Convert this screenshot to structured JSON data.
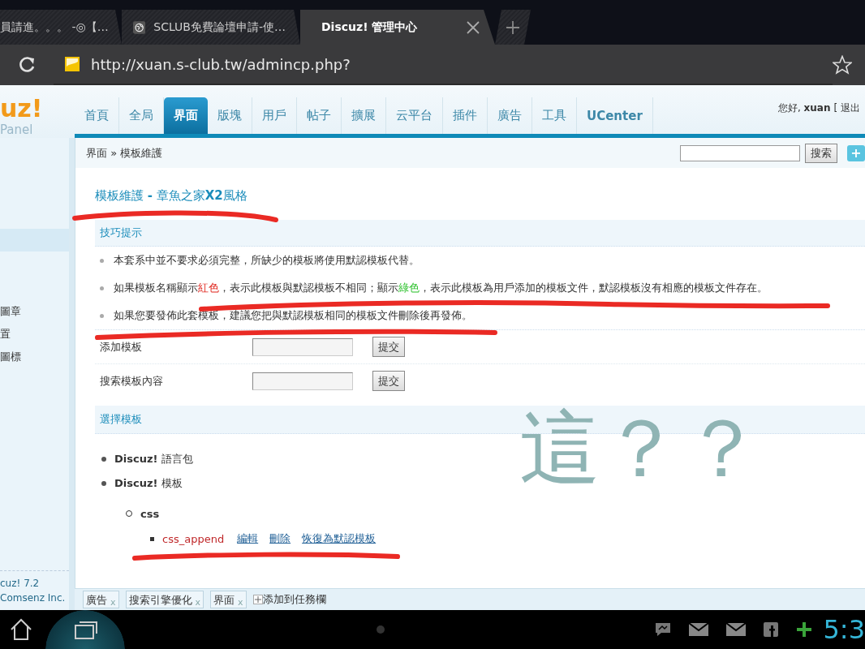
{
  "browser": {
    "tabs": [
      {
        "title": "員請進。。。 -◎【…",
        "selected": false,
        "kind": "plain"
      },
      {
        "title": "SCLUB免費論壇申請-使…",
        "selected": false,
        "kind": "globe"
      },
      {
        "title": "Discuz! 管理中心",
        "selected": true,
        "kind": "plain"
      }
    ],
    "url": "http://xuan.s-club.tw/admincp.php?"
  },
  "header": {
    "logo": "uz!",
    "logo_subtitle": "Panel",
    "nav": [
      {
        "label": "首頁",
        "selected": false
      },
      {
        "label": "全局",
        "selected": false
      },
      {
        "label": "界面",
        "selected": true
      },
      {
        "label": "版塊",
        "selected": false
      },
      {
        "label": "用戶",
        "selected": false
      },
      {
        "label": "帖子",
        "selected": false
      },
      {
        "label": "擴展",
        "selected": false
      },
      {
        "label": "云平台",
        "selected": false
      },
      {
        "label": "插件",
        "selected": false
      },
      {
        "label": "廣告",
        "selected": false
      },
      {
        "label": "工具",
        "selected": false
      },
      {
        "label": "UCenter",
        "selected": false
      }
    ],
    "greeting": "您好, **xuan**",
    "logout": "[ 退出"
  },
  "breadcrumb": "界面 » 模板維護",
  "search_button": "搜索",
  "add_button": "+",
  "sidebar": {
    "items": [
      {
        "selected": true
      },
      {
        "label": "圖章",
        "selected": false
      },
      {
        "label": "置",
        "selected": false
      },
      {
        "label": "圖標",
        "selected": false
      }
    ],
    "footer": [
      "cuz! 7.2",
      "Comsenz Inc."
    ]
  },
  "main": {
    "title": "模板維護 **-** 章魚之家**X2**風格",
    "tips": {
      "heading": "技巧提示",
      "items": [
        {
          "segments": [
            {
              "text": "本套系中並不要求必須完整，所缺少的模板將使用默認模板代替。"
            }
          ]
        },
        {
          "segments": [
            {
              "text": "如果模板名稱顯示"
            },
            {
              "text": "紅色",
              "color": "#e0261e"
            },
            {
              "text": "，表示此模板與默認模板不相同；顯示"
            },
            {
              "text": "綠色",
              "color": "#2fc22f"
            },
            {
              "text": "，表示此模板為用戶添加的模板文件，默認模板沒有相應的模板文件存在。"
            }
          ]
        },
        {
          "segments": [
            {
              "text": "如果您要發佈此套模板，建議您把與默認模板相同的模板文件刪除後再發佈。"
            }
          ]
        }
      ]
    },
    "forms": [
      {
        "label": "添加模板",
        "button": "提交"
      },
      {
        "label": "搜索模板內容",
        "button": "提交"
      }
    ],
    "select_heading": "選擇模板",
    "tree": [
      {
        "label": "**Discuz!** 語言包"
      },
      {
        "label": "**Discuz!** 模板",
        "children": [
          {
            "label": "css",
            "children": [
              {
                "label": "css_append",
                "links": [
                  "編輯",
                  "刪除",
                  "恢復為默認模板"
                ]
              }
            ]
          }
        ]
      }
    ]
  },
  "annotation": "這？？",
  "taskbar": {
    "items": [
      {
        "label": "廣告",
        "close": "x"
      },
      {
        "label": "搜索引擎優化",
        "close": "x"
      },
      {
        "label": "界面",
        "close": "x"
      }
    ],
    "add": "添加到任務欄"
  },
  "system_bar": {
    "time": "5:3"
  }
}
